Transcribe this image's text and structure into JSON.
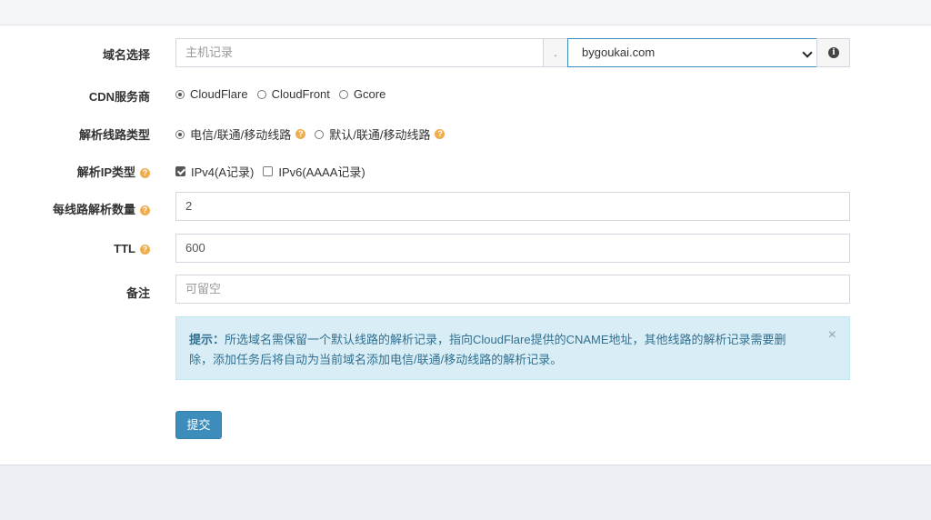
{
  "form": {
    "domain": {
      "label": "域名选择",
      "host_placeholder": "主机记录",
      "dot": ".",
      "selected_domain": "bygoukai.com",
      "info_icon": "info-circle-icon"
    },
    "cdn": {
      "label": "CDN服务商",
      "options": [
        "CloudFlare",
        "CloudFront",
        "Gcore"
      ],
      "selected": "CloudFlare"
    },
    "line_type": {
      "label": "解析线路类型",
      "options": [
        "电信/联通/移动线路",
        "默认/联通/移动线路"
      ],
      "selected": "电信/联通/移动线路",
      "help_icon": "question-circle-icon"
    },
    "ip_type": {
      "label": "解析IP类型",
      "options": [
        "IPv4(A记录)",
        "IPv6(AAAA记录)"
      ],
      "checked": [
        "IPv4(A记录)"
      ]
    },
    "per_line_count": {
      "label": "每线路解析数量",
      "value": "2"
    },
    "ttl": {
      "label": "TTL",
      "value": "600"
    },
    "remark": {
      "label": "备注",
      "placeholder": "可留空"
    },
    "alert": {
      "title": "提示：",
      "line1": "所选域名需保留一个默认线路的解析记录，指向CloudFlare提供的CNAME地址，其他线路的解析记录需要删",
      "line2": "除，添加任务后将自动为当前域名添加电信/联通/移动线路的解析记录。",
      "close": "×"
    },
    "submit_label": "提交"
  },
  "colors": {
    "primary": "#3c8dbc",
    "help": "#f0ad4e",
    "alert_bg": "#d9edf7",
    "alert_text": "#31708f",
    "page_bg": "#ecf0f5"
  }
}
